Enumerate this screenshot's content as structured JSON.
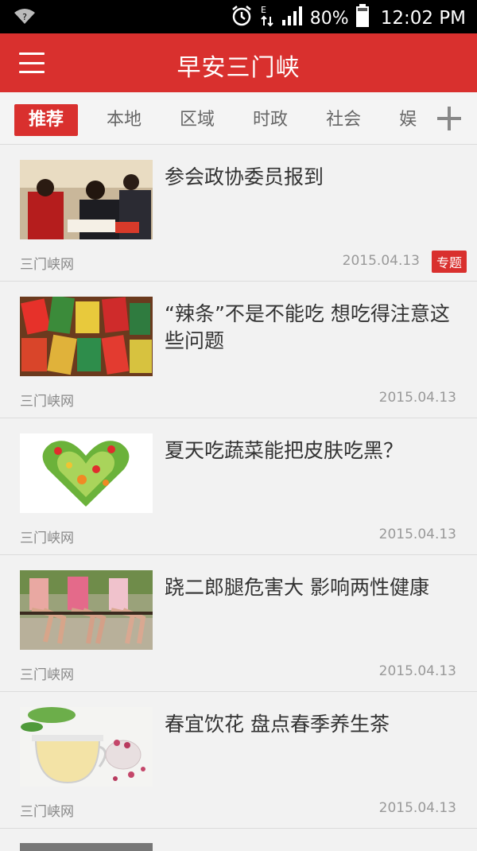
{
  "status_bar": {
    "battery": "80%",
    "time": "12:02 PM",
    "icons": [
      "wifi-question-icon",
      "alarm-icon",
      "data-transfer-icon",
      "signal-icon",
      "battery-icon"
    ]
  },
  "app_bar": {
    "title": "早安三门峡",
    "menu_icon": "hamburger-menu-icon",
    "color": "#d9302e"
  },
  "tabs": [
    "推荐",
    "本地",
    "区域",
    "时政",
    "社会",
    "娱"
  ],
  "active_tab": "推荐",
  "news": [
    {
      "title": "参会政协委员报到",
      "source": "三门峡网",
      "date": "2015.04.13",
      "badge": "专题"
    },
    {
      "title": "“辣条”不是不能吃 想吃得注意这些问题",
      "source": "三门峡网",
      "date": "2015.04.13"
    },
    {
      "title": "夏天吃蔬菜能把皮肤吃黑？",
      "source": "三门峡网",
      "date": "2015.04.13"
    },
    {
      "title": "跷二郎腿危害大 影响两性健康",
      "source": "三门峡网",
      "date": "2015.04.13"
    },
    {
      "title": "春宜饮花 盘点春季养生茶",
      "source": "三门峡网",
      "date": "2015.04.13"
    }
  ]
}
